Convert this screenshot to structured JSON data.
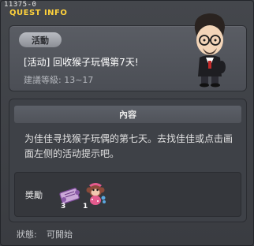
{
  "window": {
    "quest_id": "11375-0",
    "title": "QUEST INFO"
  },
  "quest": {
    "tag": "活動",
    "name": "[活动] 回收猴子玩偶第7天!",
    "level_label": "建議等級: 13~17"
  },
  "content": {
    "header": "內容",
    "description": "为佳佳寻找猴子玩偶的第七天。去找佳佳或点击画面左侧的活动提示吧。"
  },
  "reward": {
    "label": "獎勵",
    "items": [
      {
        "icon": "scroll-item-icon",
        "count": "3"
      },
      {
        "icon": "monkey-doll-item-icon",
        "count": "1"
      }
    ]
  },
  "status": {
    "label": "狀態:",
    "value": "可開始"
  },
  "npc": {
    "icon": "npc-portrait-icon"
  }
}
